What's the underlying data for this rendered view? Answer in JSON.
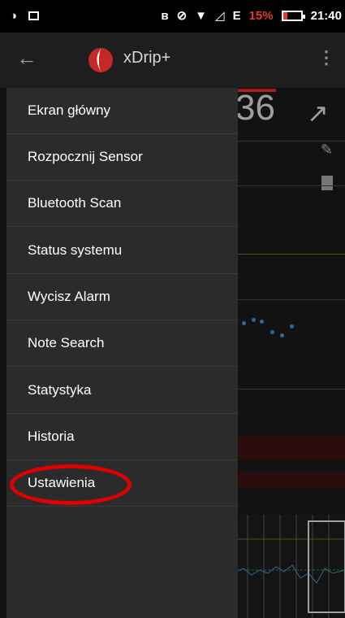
{
  "status_bar": {
    "battery": "15%",
    "time": "21:40",
    "network": "E"
  },
  "app_bar": {
    "title": "xDrip+"
  },
  "background": {
    "glucose_fragment": "36",
    "trend_arrow": "↗"
  },
  "drawer": {
    "items": [
      {
        "label": "Ekran główny"
      },
      {
        "label": "Rozpocznij Sensor"
      },
      {
        "label": "Bluetooth Scan"
      },
      {
        "label": "Status systemu"
      },
      {
        "label": "Wycisz Alarm"
      },
      {
        "label": "Note Search"
      },
      {
        "label": "Statystyka"
      },
      {
        "label": "Historia"
      },
      {
        "label": "Ustawienia"
      }
    ]
  },
  "annotation": {
    "highlight_color": "#e00000",
    "highlighted_item": "Ustawienia"
  },
  "colors": {
    "drawer_bg": "#2b2b2b",
    "app_bar_bg": "#1e1e1e",
    "logo_red": "#c62828",
    "battery_red": "#e53935"
  }
}
